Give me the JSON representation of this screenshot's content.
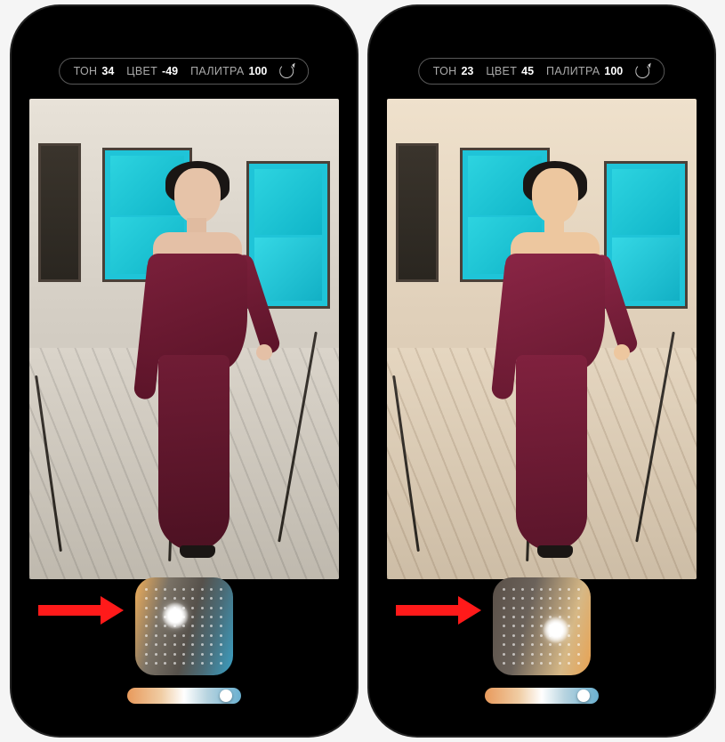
{
  "phones": [
    {
      "params": {
        "tone_label": "ТОН",
        "tone_value": "34",
        "color_label": "ЦВЕТ",
        "color_value": "-49",
        "palette_label": "ПАЛИТРА",
        "palette_value": "100"
      },
      "slider_knob_pct": 82
    },
    {
      "params": {
        "tone_label": "ТОН",
        "tone_value": "23",
        "color_label": "ЦВЕТ",
        "color_value": "45",
        "palette_label": "ПАЛИТРА",
        "palette_value": "100"
      },
      "slider_knob_pct": 82
    }
  ]
}
